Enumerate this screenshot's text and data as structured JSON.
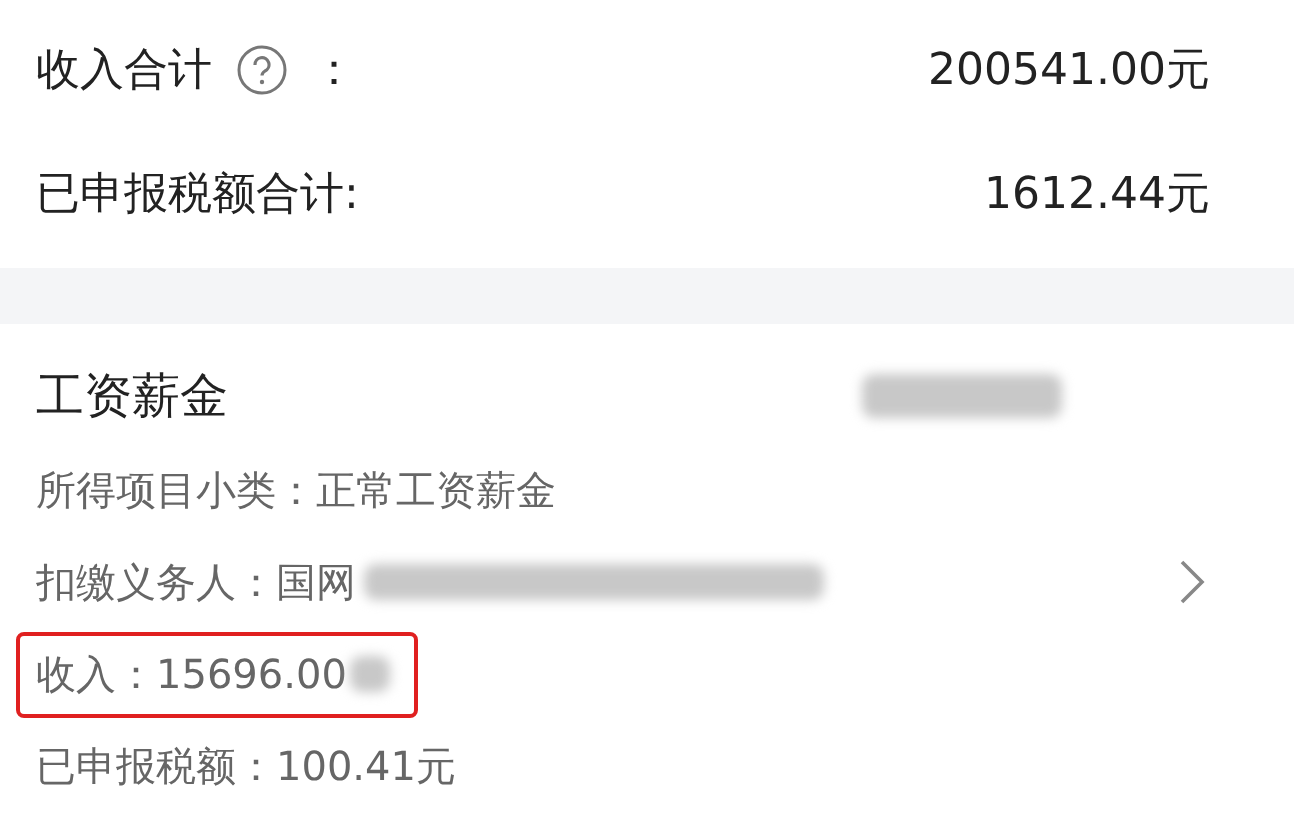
{
  "summary": [
    {
      "label": "收入合计",
      "help": true,
      "colon": "：",
      "value": "200541.00元"
    },
    {
      "label": "已申报税额合计:",
      "value": "1612.44元"
    }
  ],
  "record": {
    "title": "工资薪金",
    "title_blurred": true,
    "details": [
      {
        "text": "所得项目小类：正常工资薪金"
      },
      {
        "text": "扣缴义务人：国网",
        "blurred": true,
        "chevron": true
      },
      {
        "text": "收入：15696.00",
        "blurred": true,
        "highlighted": true
      },
      {
        "text": "已申报税额：100.41元"
      }
    ]
  }
}
